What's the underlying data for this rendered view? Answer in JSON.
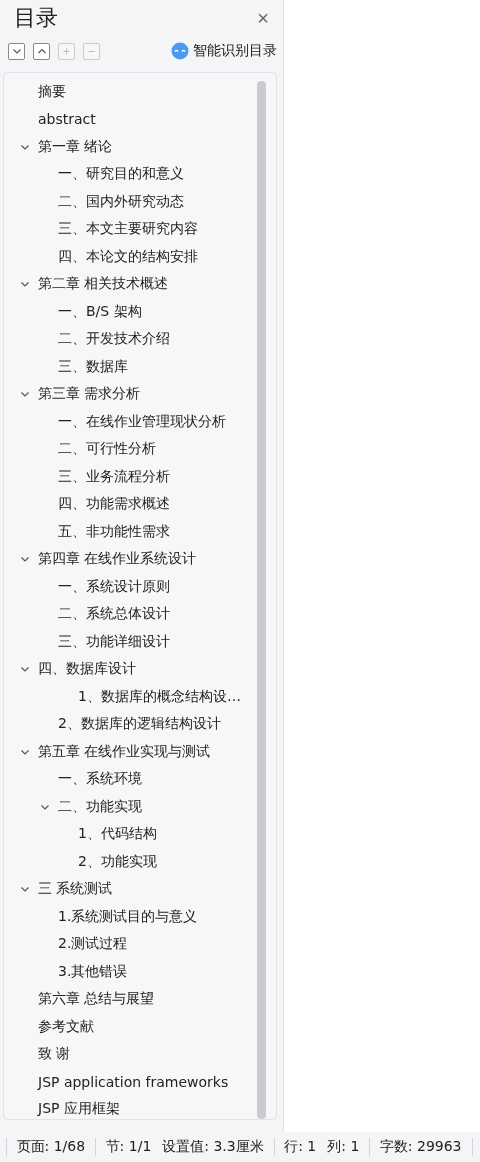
{
  "panel": {
    "title": "目录",
    "close": "×",
    "tools": [
      {
        "kind": "collapse",
        "disabled": false
      },
      {
        "kind": "expand",
        "disabled": false
      },
      {
        "kind": "add",
        "disabled": true
      },
      {
        "kind": "remove",
        "disabled": true
      }
    ],
    "smart_button": "智能识别目录"
  },
  "tree": [
    {
      "label": "摘要"
    },
    {
      "label": "abstract"
    },
    {
      "label": "第一章  绪论",
      "expanded": true,
      "children": [
        {
          "label": "一、研究目的和意义"
        },
        {
          "label": "二、国内外研究动态"
        },
        {
          "label": "三、本文主要研究内容"
        },
        {
          "label": "四、本论文的结构安排"
        }
      ]
    },
    {
      "label": "第二章  相关技术概述",
      "expanded": true,
      "children": [
        {
          "label": "一、B/S 架构"
        },
        {
          "label": "二、开发技术介绍"
        },
        {
          "label": "三、数据库"
        }
      ]
    },
    {
      "label": "第三章  需求分析",
      "expanded": true,
      "children": [
        {
          "label": "一、在线作业管理现状分析"
        },
        {
          "label": "二、可行性分析"
        },
        {
          "label": "三、业务流程分析"
        },
        {
          "label": "四、功能需求概述"
        },
        {
          "label": "五、非功能性需求"
        }
      ]
    },
    {
      "label": "第四章  在线作业系统设计",
      "expanded": true,
      "children": [
        {
          "label": "一、系统设计原则"
        },
        {
          "label": "二、系统总体设计"
        },
        {
          "label": "三、功能详细设计"
        }
      ]
    },
    {
      "label": "四、数据库设计",
      "expanded": true,
      "children": [
        {
          "label": "1、数据库的概念结构设…",
          "kind": "deep"
        },
        {
          "label": "2、数据库的逻辑结构设计"
        }
      ]
    },
    {
      "label": "第五章  在线作业实现与测试",
      "expanded": true,
      "children": [
        {
          "label": "一、系统环境"
        },
        {
          "label": "二、功能实现",
          "expanded": true,
          "children": [
            {
              "label": "1、代码结构"
            },
            {
              "label": "2、功能实现"
            }
          ]
        }
      ]
    },
    {
      "label": "三  系统测试",
      "expanded": true,
      "children": [
        {
          "label": "1.系统测试目的与意义"
        },
        {
          "label": "2.测试过程"
        },
        {
          "label": "3.其他错误"
        }
      ]
    },
    {
      "label": "第六章  总结与展望"
    },
    {
      "label": "参考文献"
    },
    {
      "label": "致    谢"
    },
    {
      "label": "JSP application frameworks"
    },
    {
      "label": "JSP 应用框架"
    }
  ],
  "status_bar": [
    {
      "items": [
        "页面: 1/68"
      ]
    },
    {
      "items": [
        "节: 1/1",
        "设置值: 3.3厘米"
      ]
    },
    {
      "items": [
        "行: 1",
        "列: 1"
      ]
    },
    {
      "items": [
        "字数: 29963"
      ]
    }
  ]
}
